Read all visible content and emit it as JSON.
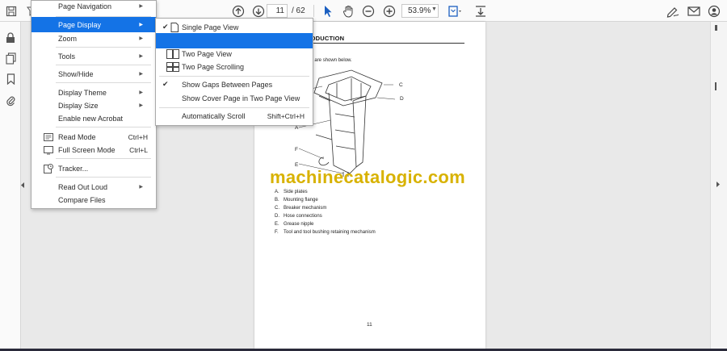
{
  "toolbar": {
    "page_current": "11",
    "page_total": "/  62",
    "zoom": "53.9%"
  },
  "main_menu": {
    "items": [
      {
        "label": "Page Navigation"
      },
      {
        "label": "Page Display"
      },
      {
        "label": "Zoom"
      },
      {
        "label": "Tools"
      },
      {
        "label": "Show/Hide"
      },
      {
        "label": "Display Theme"
      },
      {
        "label": "Display Size"
      },
      {
        "label": "Enable new Acrobat"
      },
      {
        "label": "Read Mode",
        "shortcut": "Ctrl+H"
      },
      {
        "label": "Full Screen Mode",
        "shortcut": "Ctrl+L"
      },
      {
        "label": "Tracker..."
      },
      {
        "label": "Read Out Loud"
      },
      {
        "label": "Compare Files"
      }
    ]
  },
  "sub_menu": {
    "items": [
      {
        "label": "Single Page View",
        "checked": true
      },
      {
        "label": "",
        "highlighted": true
      },
      {
        "label": "Two Page View"
      },
      {
        "label": "Two Page Scrolling"
      },
      {
        "label": "Show Gaps Between Pages",
        "checked": true
      },
      {
        "label": "Show Cover Page in Two Page View"
      },
      {
        "label": "Automatically Scroll",
        "shortcut": "Shift+Ctrl+H"
      }
    ]
  },
  "document": {
    "heading": "RODUCTION",
    "intro": "he breaker are shown below.",
    "callouts": [
      "A",
      "B",
      "C",
      "D",
      "E",
      "F"
    ],
    "parts": [
      {
        "letter": "A.",
        "text": "Side plates"
      },
      {
        "letter": "B.",
        "text": "Mounting flange"
      },
      {
        "letter": "C.",
        "text": "Breaker mechanism"
      },
      {
        "letter": "D.",
        "text": "Hose connections"
      },
      {
        "letter": "E.",
        "text": "Grease nipple"
      },
      {
        "letter": "F.",
        "text": "Tool and tool bushing retaining mechanism"
      }
    ],
    "page_number": "11",
    "watermark": "machinecatalogic.com"
  },
  "colors": {
    "accent": "#1473e6",
    "watermark": "#d8b200"
  },
  "icons": [
    "save-icon",
    "filter-icon",
    "arrow-up-circle-icon",
    "arrow-down-circle-icon",
    "select-pointer-icon",
    "hand-icon",
    "zoom-out-icon",
    "zoom-in-icon",
    "page-fit-icon",
    "scroll-mode-icon",
    "sign-icon",
    "mail-icon",
    "user-icon",
    "lock-icon",
    "pages-icon",
    "bookmark-icon",
    "attachment-icon"
  ]
}
